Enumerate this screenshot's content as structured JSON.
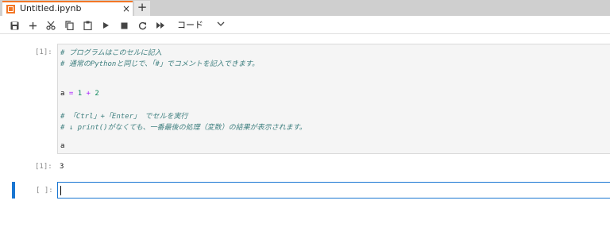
{
  "tab": {
    "title": "Untitled.ipynb",
    "close": "×",
    "new_tab": "+"
  },
  "toolbar": {
    "buttons": [
      "save-icon",
      "add-cell-icon",
      "cut-icon",
      "copy-icon",
      "paste-icon",
      "run-icon",
      "stop-icon",
      "restart-icon",
      "run-all-icon"
    ],
    "cell_type": "コード"
  },
  "cells": {
    "code_prompt": "[1]:",
    "lines": {
      "l1": "# プログラムはこのセルに記入",
      "l2": "# 通常のPythonと同じで、「#」でコメントを記入できます。",
      "l3_var": "a",
      "l3_eq": "=",
      "l3_a": "1",
      "l3_plus": "+",
      "l3_b": "2",
      "l4": "# 「Ctrl」+「Enter」 でセルを実行",
      "l5": "# ↓ print()がなくても、一番最後の処理（変数）の結果が表示されます。",
      "l6": "a"
    },
    "output_prompt": "[1]:",
    "output_value": "3",
    "empty_prompt": "[ ]:"
  },
  "colors": {
    "accent": "#1976d2",
    "tab_accent": "#f37726"
  }
}
